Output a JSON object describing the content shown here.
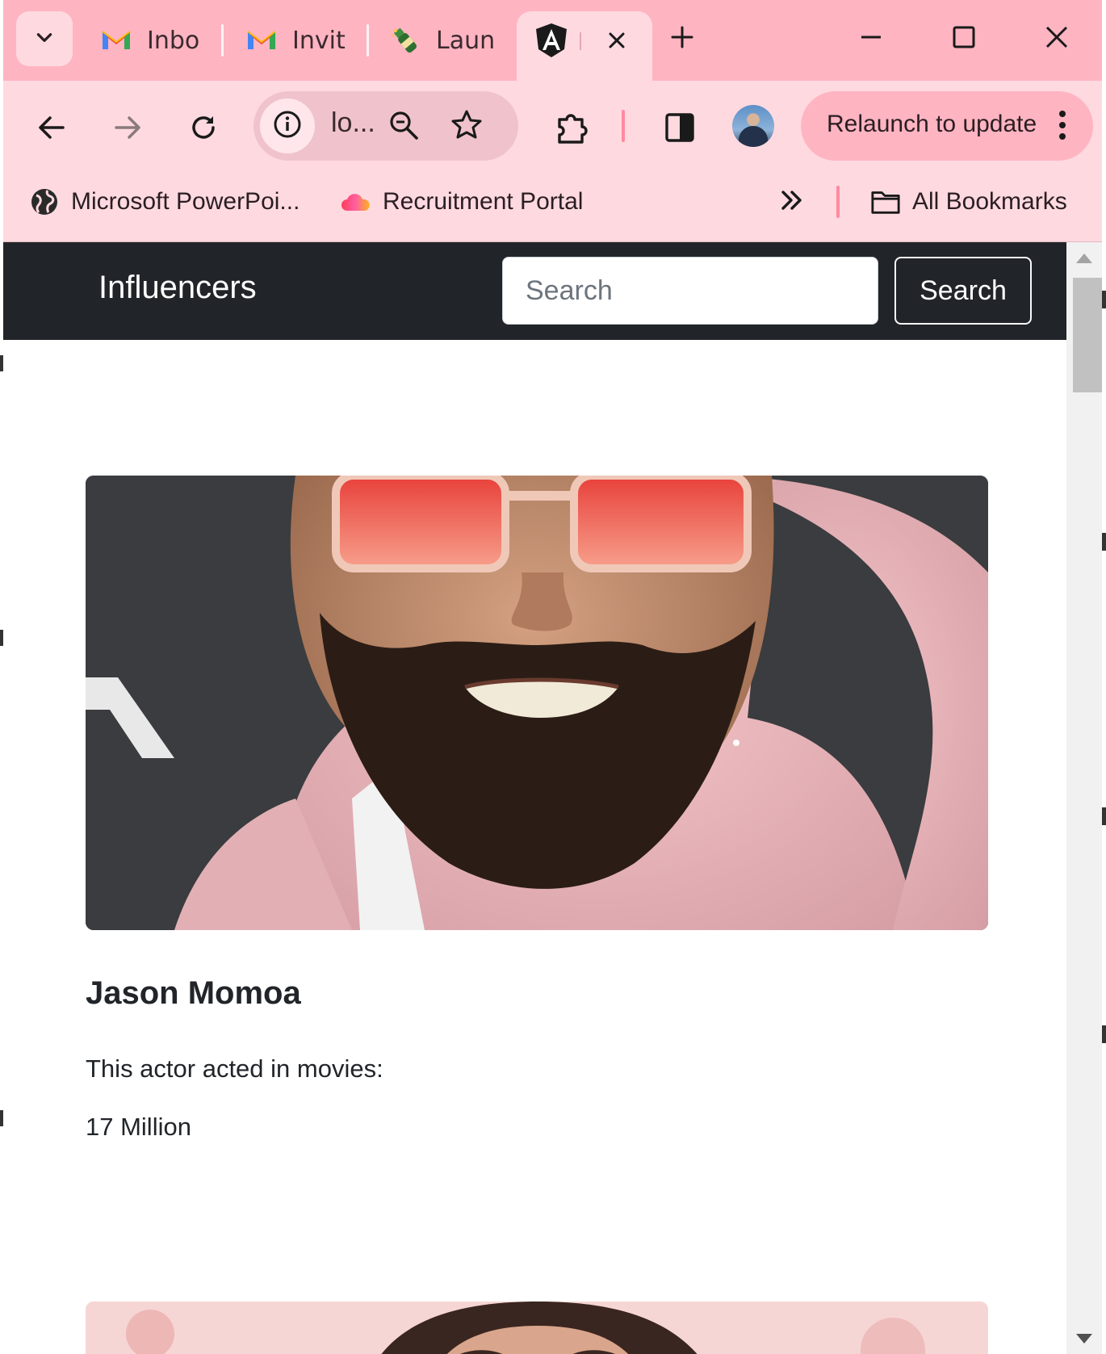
{
  "browser": {
    "tabs": [
      {
        "title": "Inbo",
        "icon": "gmail-icon"
      },
      {
        "title": "Invit",
        "icon": "gmail-icon"
      },
      {
        "title": "Laun",
        "icon": "champagne-icon"
      },
      {
        "title": "",
        "icon": "angular-icon",
        "active": true
      }
    ],
    "address_text": "lo...",
    "relaunch_label": "Relaunch to update",
    "bookmarks": [
      {
        "label": "Microsoft PowerPoi...",
        "icon": "globe-icon"
      },
      {
        "label": "Recruitment Portal",
        "icon": "cloud-icon"
      }
    ],
    "all_bookmarks_label": "All Bookmarks"
  },
  "page": {
    "brand": "Influencers",
    "search_placeholder": "Search",
    "search_button": "Search",
    "cards": [
      {
        "name": "Jason Momoa",
        "text": "This actor acted in movies:",
        "followers": "17 Million"
      }
    ]
  },
  "colors": {
    "tabstrip": "#ffb4c2",
    "toolbar": "#ffd9e0",
    "navbar": "#212529"
  }
}
